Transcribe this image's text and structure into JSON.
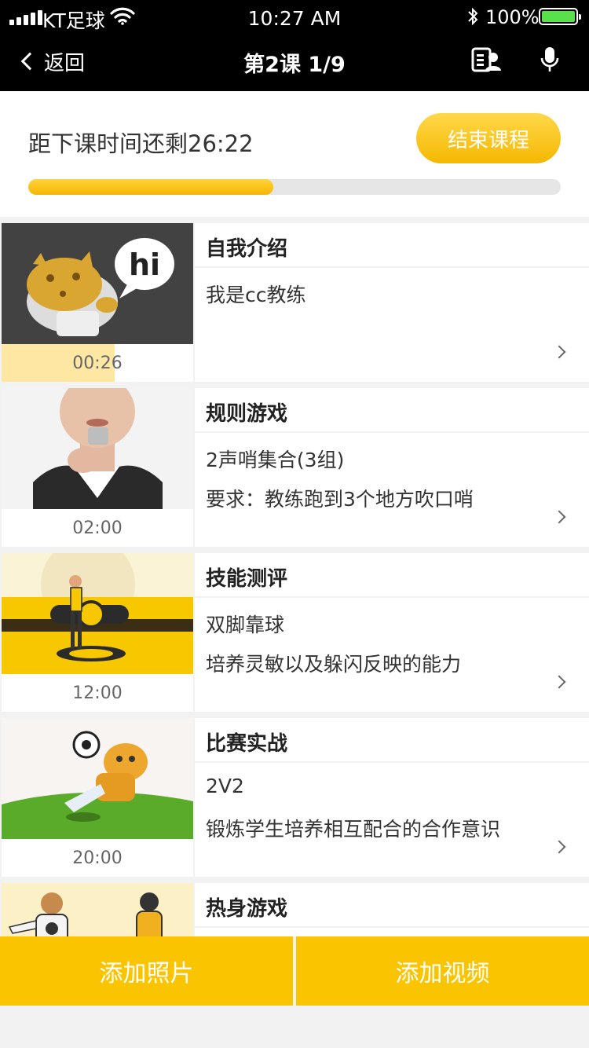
{
  "status_bar": {
    "carrier": "KT足球",
    "time": "10:27 AM",
    "battery_pct": "100%",
    "battery_fill": 1.0
  },
  "nav": {
    "back_label": "返回",
    "title": "第2课 1/9",
    "icons": [
      "roster-icon",
      "microphone-icon"
    ]
  },
  "timer": {
    "text": "距下课时间还剩26:22",
    "end_button": "结束课程",
    "progress": 0.46
  },
  "items": [
    {
      "title": "自我介绍",
      "line1": "我是cc教练",
      "line2": "",
      "duration": "00:26",
      "played": 0.59,
      "thumb": "mascot-hi"
    },
    {
      "title": "规则游戏",
      "line1": "2声哨集合(3组)",
      "line2": "要求：教练跑到3个地方吹口哨",
      "duration": "02:00",
      "played": 0,
      "thumb": "whistle"
    },
    {
      "title": "技能测评",
      "line1": "双脚靠球",
      "line2": "培养灵敏以及躲闪反映的能力",
      "duration": "12:00",
      "played": 0,
      "thumb": "kt-player"
    },
    {
      "title": "比赛实战",
      "line1": "2V2",
      "line2": "锻炼学生培养相互配合的合作意识",
      "duration": "20:00",
      "played": 0,
      "thumb": "mascot-kick"
    },
    {
      "title": "热身游戏",
      "line1": "",
      "line2": "",
      "duration": "",
      "played": 0,
      "thumb": "players"
    }
  ],
  "bottom": {
    "add_photo": "添加照片",
    "add_video": "添加视频"
  },
  "colors": {
    "accent": "#fbc400",
    "nav_bg": "#000000",
    "progress_track": "#e6e6e6",
    "battery": "#5ae04a"
  }
}
